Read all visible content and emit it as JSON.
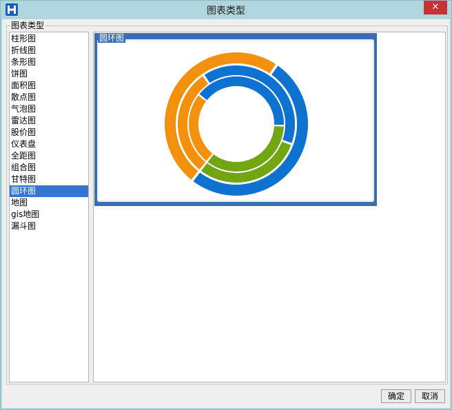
{
  "window": {
    "title": "图表类型",
    "close_symbol": "✕",
    "app_icon": "h-logo-icon",
    "accent": "#3574d1"
  },
  "group": {
    "legend": "图表类型"
  },
  "chart_types": [
    "柱形图",
    "折线图",
    "条形图",
    "饼图",
    "面积图",
    "散点图",
    "气泡图",
    "雷达图",
    "股价图",
    "仪表盘",
    "全距图",
    "组合图",
    "甘特图",
    "圆环图",
    "地图",
    "gis地图",
    "漏斗图"
  ],
  "selected_index": 13,
  "preview": {
    "title": "圆环图"
  },
  "chart_data": {
    "type": "doughnut",
    "rings": [
      {
        "segments": [
          {
            "color": "#f3900e",
            "value": 0.49
          },
          {
            "color": "#0e72d1",
            "value": 0.51
          }
        ]
      },
      {
        "segments": [
          {
            "color": "#f3900e",
            "value": 0.3
          },
          {
            "color": "#0e72d1",
            "value": 0.4
          },
          {
            "color": "#72a512",
            "value": 0.3
          }
        ]
      },
      {
        "segments": [
          {
            "color": "#f3900e",
            "value": 0.25
          },
          {
            "color": "#0e72d1",
            "value": 0.4
          },
          {
            "color": "#72a512",
            "value": 0.35
          }
        ]
      }
    ],
    "colors": {
      "orange": "#f3900e",
      "blue": "#0e72d1",
      "green": "#72a512"
    }
  },
  "buttons": {
    "ok_label": "确定",
    "cancel_label": "取消"
  }
}
